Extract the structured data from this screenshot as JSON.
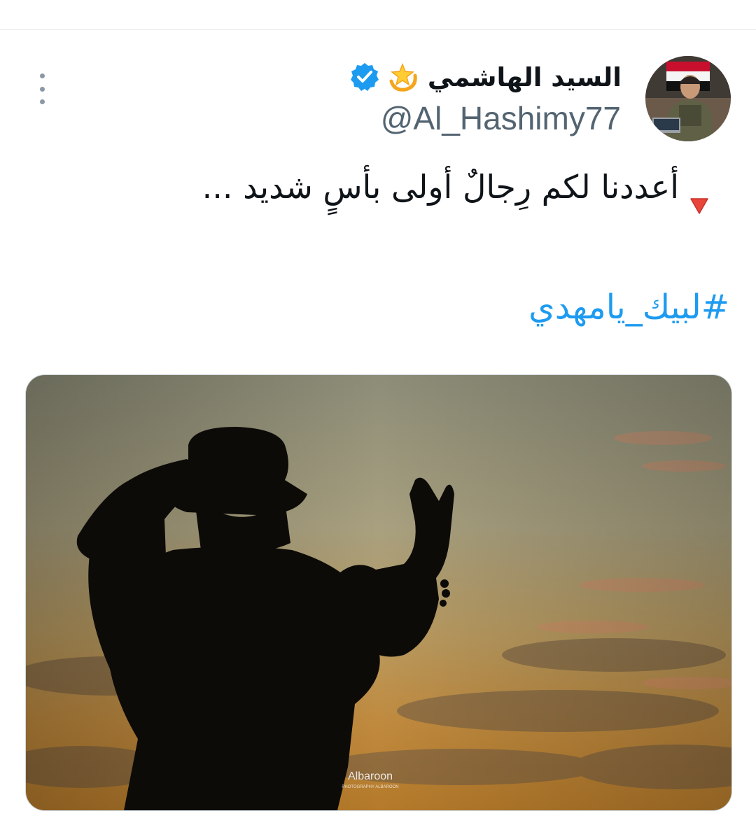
{
  "tweet": {
    "author": {
      "display_name": "السيد الهاشمي",
      "emoji_icon": "dizzy-icon",
      "verified_icon": "verified-badge-icon",
      "handle": "@Al_Hashimy77",
      "avatar": "avatar"
    },
    "text_icon": "red-triangle-down-icon",
    "text": "أعددنا لكم رِجالٌ أولى بأسٍ شديد ...",
    "hashtag": "#لبيك_يامهدي",
    "more_icon": "more-vertical-icon",
    "media": {
      "description_icon": "photo",
      "watermark": "Albaroon",
      "watermark_sub": "PHOTOGRAPHY ALBAROON"
    },
    "colors": {
      "link": "#1d9bf0",
      "verified": "#1d9bf0",
      "handle": "#536471",
      "text": "#0f1419"
    }
  }
}
